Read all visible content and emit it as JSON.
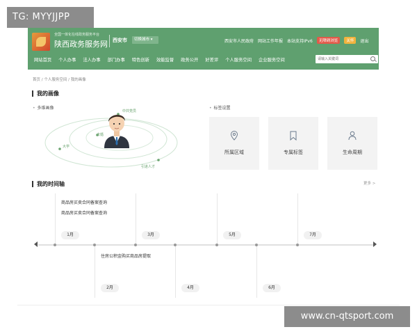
{
  "watermark": {
    "top_left": "TG: MYYJJPP",
    "bottom_right": "www.cn-qtsport.com"
  },
  "header": {
    "slogan": "全国一体化在线政务服务平台",
    "site_name": "陕西政务服务网",
    "city": "西安市",
    "city_switch": "切换城市 ▾",
    "links": [
      "西安市人民政府",
      "网站工作年报",
      "本站支持IPv6"
    ],
    "badge_red": "无障碍浏览",
    "badge_yellow": "关怀",
    "exit": "退出"
  },
  "nav": {
    "items": [
      "网站首页",
      "个人办事",
      "法人办事",
      "部门办事",
      "特色创新",
      "效能监督",
      "政务公开",
      "好差评",
      "个人服务空间",
      "企业服务空间"
    ],
    "search_placeholder": "请输入关键词"
  },
  "breadcrumb": "首页 / 个人服务空间 / 我的画像",
  "portrait": {
    "title": "我的画像",
    "multi_dimension": "多维画像",
    "tag_settings": "标签设置",
    "orbit_labels": [
      "中共党员",
      "未婚",
      "大学",
      "引进人才"
    ],
    "tiles": [
      {
        "icon": "location-pin-icon",
        "label": "所属区域"
      },
      {
        "icon": "bookmark-icon",
        "label": "专属标签"
      },
      {
        "icon": "person-icon",
        "label": "生命周期"
      }
    ]
  },
  "timeline": {
    "title": "我的时间轴",
    "more": "更多 >",
    "months_top": [
      "1月",
      "3月",
      "5月",
      "7月"
    ],
    "months_bottom": [
      "2月",
      "4月",
      "6月"
    ],
    "events_jan": [
      "商品房买卖合同备案查询",
      "商品房买卖合同备案查询"
    ],
    "events_feb": [
      "住房公积金购买商品房提取"
    ]
  },
  "colors": {
    "brand_green": "#5fa06f",
    "accent_red": "#e25a4a",
    "accent_yellow": "#f2b33d"
  }
}
